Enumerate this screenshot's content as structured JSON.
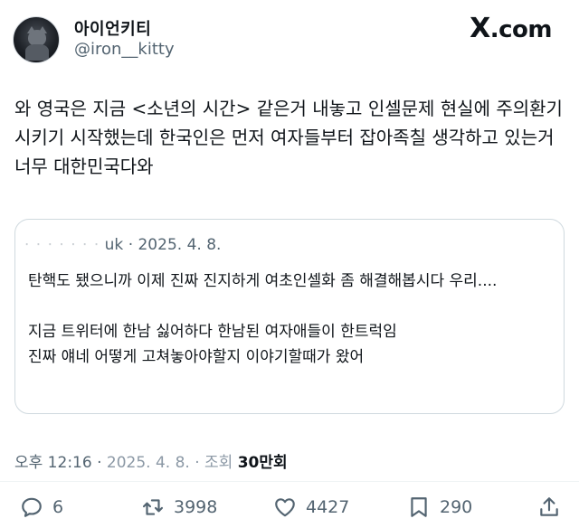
{
  "header": {
    "display_name": "아이언키티",
    "handle": "@iron__kitty",
    "site_logo": ".com",
    "site_logo_x": "X"
  },
  "tweet": {
    "text": "와 영국은 지금 <소년의 시간> 같은거 내놓고 인셀문제 현실에 주의환기 시키기 시작했는데 한국인은 먼저 여자들부터 잡아족칠 생각하고 있는거 너무 대한민국다와"
  },
  "quote": {
    "author_fragment": "uk",
    "date": "· 2025. 4. 8.",
    "text_line1": "탄핵도 됐으니까 이제 진짜 진지하게 여초인셀화 좀 해결해봅시다 우리....",
    "text_line2": "지금 트위터에 한남 싫어하다 한남된 여자애들이 한트럭임\n진짜 얘네 어떻게 고쳐놓아야할지 이야기할때가 왔어"
  },
  "meta": {
    "time": "오후 12:16 · ",
    "date_partial": "2025. 4. 8.",
    "views_label": "· 조회 ",
    "views_count": "30만회"
  },
  "actions": {
    "replies": "6",
    "retweets": "3998",
    "likes": "4427",
    "bookmarks": "290"
  },
  "icons": [
    "reply-icon",
    "retweet-icon",
    "like-icon",
    "bookmark-icon",
    "share-icon"
  ]
}
